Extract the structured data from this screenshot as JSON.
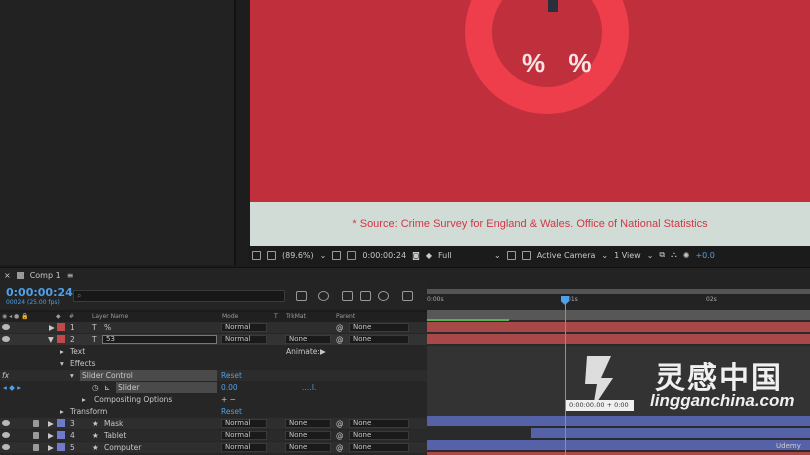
{
  "viewer": {
    "percent_text": "% %",
    "source_text": "* Source: Crime Survey for England & Wales. Office of National Statistics",
    "toolbar": {
      "zoom": "(89.6%)",
      "timecode": "0:00:00:24",
      "resolution": "Full",
      "camera": "Active Camera",
      "views": "1 View",
      "exposure": "+0.0"
    },
    "colors": {
      "background": "#c0303c",
      "ring": "#ee3d4b",
      "footer": "#d2dcd7"
    }
  },
  "timeline": {
    "tab": "Comp 1",
    "timecode": "0:00:00:24",
    "fps": "00024 (25.00 fps)",
    "search_placeholder": "",
    "columns": {
      "num": "#",
      "layer_name": "Layer Name",
      "mode": "Mode",
      "t": "T",
      "trkmat": "TrkMat",
      "parent": "Parent"
    },
    "ruler": {
      "t0": "0:00s",
      "t1": "01s",
      "t2": "02s"
    },
    "layers": [
      {
        "num": "1",
        "name": "%",
        "mode": "Normal",
        "trkmat": "",
        "parent": "None",
        "color": "#b04040"
      },
      {
        "num": "2",
        "name": "53",
        "mode": "Normal",
        "trkmat": "None",
        "parent": "None",
        "color": "#b04040"
      }
    ],
    "properties": {
      "text": "Text",
      "animate": "Animate:",
      "effects": "Effects",
      "slider_control": "Slider Control",
      "reset1": "Reset",
      "slider": "Slider",
      "slider_value": "0.00",
      "compositing": "Compositing Options",
      "plusminus": "+ −",
      "transform": "Transform",
      "reset2": "Reset",
      "fx": "fx"
    },
    "lower_layers": [
      {
        "num": "3",
        "name": "Mask",
        "mode": "Normal",
        "trkmat": "None",
        "parent": "None"
      },
      {
        "num": "4",
        "name": "Tablet",
        "mode": "Normal",
        "trkmat": "None",
        "parent": "None"
      },
      {
        "num": "5",
        "name": "Computer",
        "mode": "Normal",
        "trkmat": "None",
        "parent": "None"
      }
    ],
    "tooltip": "0:00:00:00 + 0:00"
  },
  "watermark": {
    "title": "灵感中国",
    "subtitle": "lingganchina.com",
    "udemy": "Udemy"
  }
}
